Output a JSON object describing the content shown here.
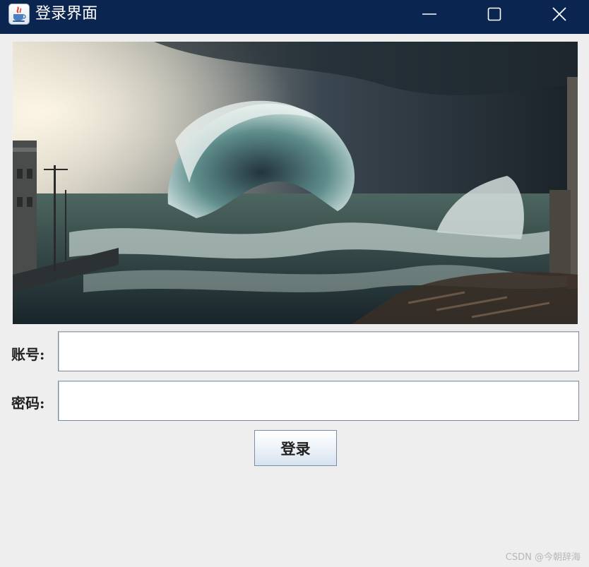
{
  "window": {
    "title": "登录界面",
    "controls": {
      "minimize": "minimize-icon",
      "maximize": "maximize-icon",
      "close": "close-icon"
    }
  },
  "hero": {
    "description_icon": "ocean-wave-image"
  },
  "form": {
    "account_label": "账号:",
    "account_value": "",
    "password_label": "密码:",
    "password_value": "",
    "login_label": "登录"
  },
  "watermark": "CSDN @今朝辞海",
  "colors": {
    "titlebar": "#0a254f",
    "background": "#eeeeee",
    "button_gradient_bottom": "#d6e2ef"
  }
}
